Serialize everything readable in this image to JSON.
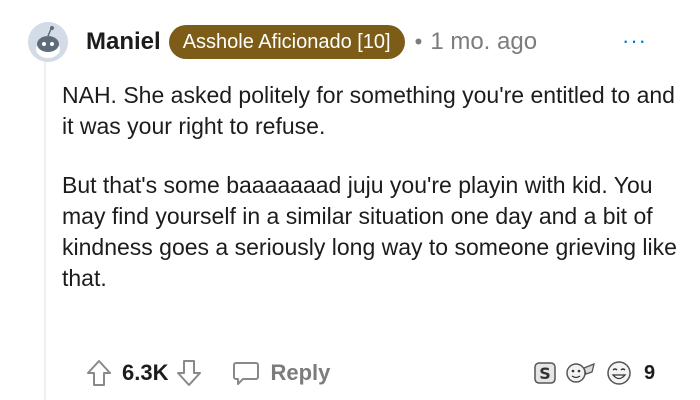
{
  "comment": {
    "author": "Maniel",
    "flair": "Asshole Aficionado [10]",
    "separator": "•",
    "timestamp": "1 mo. ago",
    "more_label": "···",
    "paragraphs": [
      "NAH. She asked politely for something you're entitled to and it was your right to refuse.",
      "But that's some baaaaaaad juju you're playin with kid. You may find yourself in a similar situation one day and a bit of kindness goes a seriously long way to someone grieving like that."
    ]
  },
  "actions": {
    "upvote_icon": "arrow-up-icon",
    "score": "6.3K",
    "downvote_icon": "arrow-down-icon",
    "reply_icon": "speech-bubble-icon",
    "reply_label": "Reply"
  },
  "awards": {
    "icons": [
      "silver-award-icon",
      "wholesome-award-icon",
      "laughing-award-icon"
    ],
    "count": "9"
  },
  "colors": {
    "flair_bg": "#7d5c18",
    "muted": "#7c7c7c",
    "text": "#1c1c1c",
    "link": "#0079d3"
  }
}
